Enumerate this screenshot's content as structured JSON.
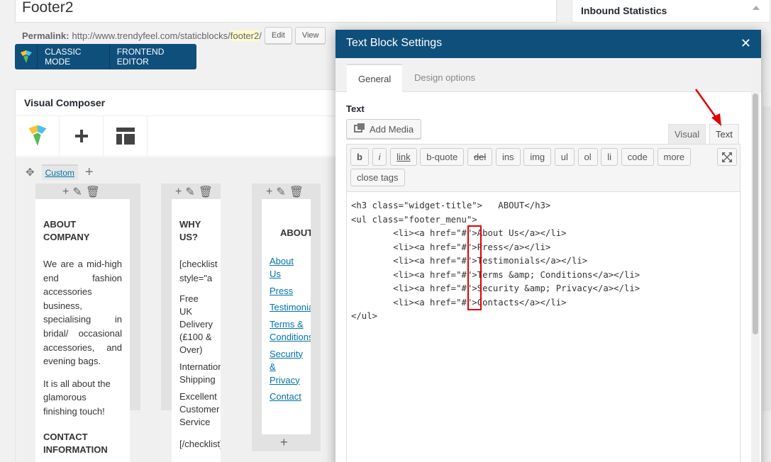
{
  "post": {
    "title": "Footer2",
    "permalink_label": "Permalink:",
    "permalink_base": "http://www.trendyfeel.com/staticblocks/",
    "permalink_slug": "footer2",
    "permalink_tail": "/",
    "edit_label": "Edit",
    "view_label": "View"
  },
  "modebar": {
    "classic_label": "CLASSIC MODE",
    "frontend_label": "FRONTEND EDITOR"
  },
  "sidebar": {
    "box_title": "Inbound Statistics"
  },
  "composer": {
    "title": "Visual Composer",
    "row_tab": "Custom",
    "columns": [
      {
        "heading": "ABOUT COMPANY",
        "paragraphs": [
          "We are a mid-high end fashion accessories business, specialising in bridal/ occasional accessories, and evening bags.",
          "It is all about the glamorous finishing touch!"
        ],
        "heading2": "CONTACT INFORMATION"
      },
      {
        "heading": "WHY US?",
        "lines": [
          "[checklist style=\"a",
          "Free UK Delivery (£100 & Over)",
          "International Shipping",
          "Excellent Customer Service",
          "[/checklist]"
        ]
      },
      {
        "heading": "ABOUT",
        "links": [
          "About Us",
          "Press",
          "Testimonials",
          "Terms & Conditions",
          "Security & Privacy",
          "Contact"
        ]
      }
    ]
  },
  "modal": {
    "title": "Text Block Settings",
    "tabs": [
      "General",
      "Design options"
    ],
    "field_label": "Text",
    "add_media": "Add Media",
    "editor_tabs": {
      "visual": "Visual",
      "text": "Text"
    },
    "quicktags": [
      "b",
      "i",
      "link",
      "b-quote",
      "del",
      "ins",
      "img",
      "ul",
      "ol",
      "li",
      "code",
      "more",
      "close tags"
    ],
    "code_lines": [
      "<h3 class=\"widget-title\">   ABOUT</h3>",
      "<ul class=\"footer_menu\">",
      "        <li><a href=\"#\">About Us</a></li>",
      "        <li><a href=\"#\">Press</a></li>",
      "        <li><a href=\"#\">Testimonials</a></li>",
      "        <li><a href=\"#\">Terms &amp; Conditions</a></li>",
      "        <li><a href=\"#\">Security &amp; Privacy</a></li>",
      "        <li><a href=\"#\">Contacts</a></li>",
      "</ul>"
    ]
  },
  "colors": {
    "brand": "#0f4f7c",
    "link": "#0073aa",
    "annotation": "#e00000"
  }
}
